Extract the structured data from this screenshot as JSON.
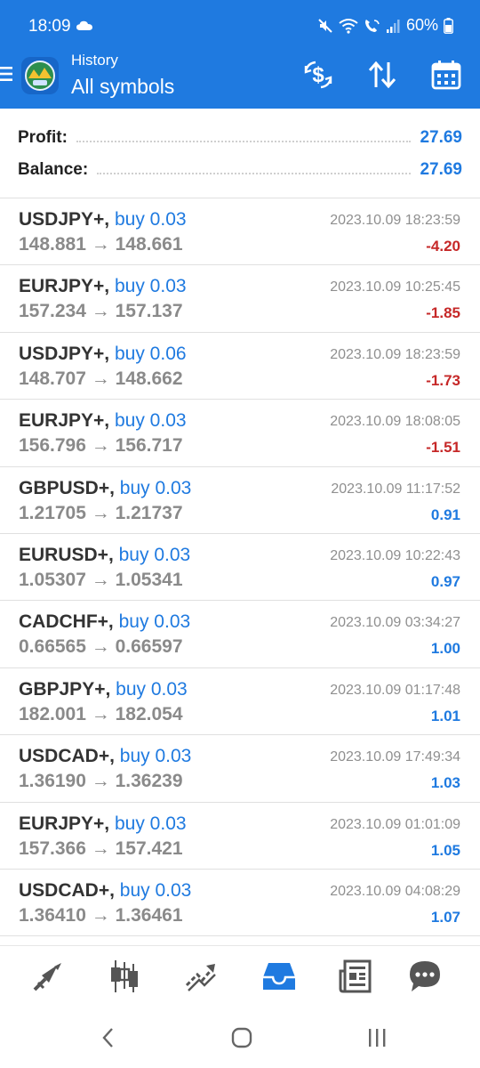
{
  "status_bar": {
    "time": "18:09",
    "battery": "60%"
  },
  "header": {
    "subtitle": "History",
    "title": "All symbols",
    "accent": "#1f7ae0"
  },
  "summary": {
    "profit_label": "Profit:",
    "profit_value": "27.69",
    "balance_label": "Balance:",
    "balance_value": "27.69"
  },
  "trades": [
    {
      "symbol": "USDJPY+,",
      "side": "buy 0.03",
      "open": "148.881",
      "close": "148.661",
      "time": "2023.10.09 18:23:59",
      "profit": "-4.20",
      "dir": "neg"
    },
    {
      "symbol": "EURJPY+,",
      "side": "buy 0.03",
      "open": "157.234",
      "close": "157.137",
      "time": "2023.10.09 10:25:45",
      "profit": "-1.85",
      "dir": "neg"
    },
    {
      "symbol": "USDJPY+,",
      "side": "buy 0.06",
      "open": "148.707",
      "close": "148.662",
      "time": "2023.10.09 18:23:59",
      "profit": "-1.73",
      "dir": "neg"
    },
    {
      "symbol": "EURJPY+,",
      "side": "buy 0.03",
      "open": "156.796",
      "close": "156.717",
      "time": "2023.10.09 18:08:05",
      "profit": "-1.51",
      "dir": "neg"
    },
    {
      "symbol": "GBPUSD+,",
      "side": "buy 0.03",
      "open": "1.21705",
      "close": "1.21737",
      "time": "2023.10.09 11:17:52",
      "profit": "0.91",
      "dir": "pos"
    },
    {
      "symbol": "EURUSD+,",
      "side": "buy 0.03",
      "open": "1.05307",
      "close": "1.05341",
      "time": "2023.10.09 10:22:43",
      "profit": "0.97",
      "dir": "pos"
    },
    {
      "symbol": "CADCHF+,",
      "side": "buy 0.03",
      "open": "0.66565",
      "close": "0.66597",
      "time": "2023.10.09 03:34:27",
      "profit": "1.00",
      "dir": "pos"
    },
    {
      "symbol": "GBPJPY+,",
      "side": "buy 0.03",
      "open": "182.001",
      "close": "182.054",
      "time": "2023.10.09 01:17:48",
      "profit": "1.01",
      "dir": "pos"
    },
    {
      "symbol": "USDCAD+,",
      "side": "buy 0.03",
      "open": "1.36190",
      "close": "1.36239",
      "time": "2023.10.09 17:49:34",
      "profit": "1.03",
      "dir": "pos"
    },
    {
      "symbol": "EURJPY+,",
      "side": "buy 0.03",
      "open": "157.366",
      "close": "157.421",
      "time": "2023.10.09 01:01:09",
      "profit": "1.05",
      "dir": "pos"
    },
    {
      "symbol": "USDCAD+,",
      "side": "buy 0.03",
      "open": "1.36410",
      "close": "1.36461",
      "time": "2023.10.09 04:08:29",
      "profit": "1.07",
      "dir": "pos"
    }
  ],
  "price_arrow": "→",
  "colors": {
    "negative": "#c62828",
    "positive": "#1f7ae0",
    "active_tab": "#1f7ae0",
    "inactive_tab": "#555555"
  },
  "bottom_nav": [
    {
      "icon": "quotes-icon",
      "active": false
    },
    {
      "icon": "chart-icon",
      "active": false
    },
    {
      "icon": "trade-icon",
      "active": false
    },
    {
      "icon": "history-icon",
      "active": true
    },
    {
      "icon": "news-icon",
      "active": false
    },
    {
      "icon": "chat-icon",
      "active": false
    }
  ]
}
